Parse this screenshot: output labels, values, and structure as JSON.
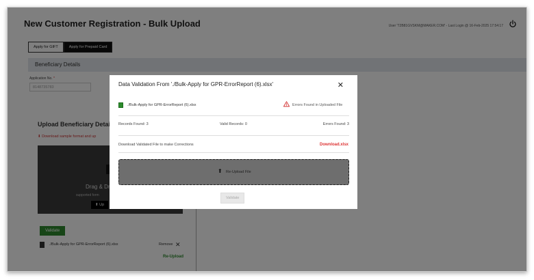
{
  "page": {
    "title": "New Customer Registration - Bulk Upload",
    "user_info": "User 'T2B81GVSKM@MAKER.COM' - Last Login @ 16-Feb-2025 17:54:17"
  },
  "tabs": [
    {
      "label": "Apply for GIFT"
    },
    {
      "label": "Apply for Prepaid Card"
    }
  ],
  "beneficiary": {
    "section_title": "Beneficiary Details",
    "app_no_label": "Application No.",
    "app_no_required": "*",
    "app_no_value": "8148735783"
  },
  "upload_panel": {
    "title": "Upload Beneficiary Details",
    "download_sample": "Download sample format and up",
    "drop_text": "Drag & Dr",
    "drop_sub": "supported form",
    "upload_btn": "Up",
    "validate_btn": "Validate",
    "file_name": "./Bulk-Apply for GPR-ErrorReport (6).xlsx",
    "remove_label": "Remove",
    "remove_x": "✕",
    "reupload": "Re-Upload"
  },
  "modal": {
    "title": "Data Validation From './Bulk-Apply for GPR-ErrorReport (6).xlsx'",
    "close": "✕",
    "file_name": "./Bulk-Apply for GPR-ErrorReport (6).xlsx",
    "error_text": "Errors Found in Uploaded File",
    "records_found": "Records Found: 3",
    "valid_records": "Valid Records: 0",
    "errors_found": "Errors Found: 3",
    "download_label": "Download Validated File to make Corrections",
    "download_link": "Download.xlsx",
    "reupload_arrow": "⬆",
    "reupload_text": "Re-Upload File",
    "validate_btn": "Validate"
  },
  "colors": {
    "accent_green": "#2e8b2e",
    "error_red": "#d33333",
    "overlay": "rgba(0,0,0,0.5)"
  },
  "icons": [
    "power-icon",
    "download-icon",
    "file-icon",
    "warning-icon",
    "upload-icon",
    "close-icon"
  ]
}
